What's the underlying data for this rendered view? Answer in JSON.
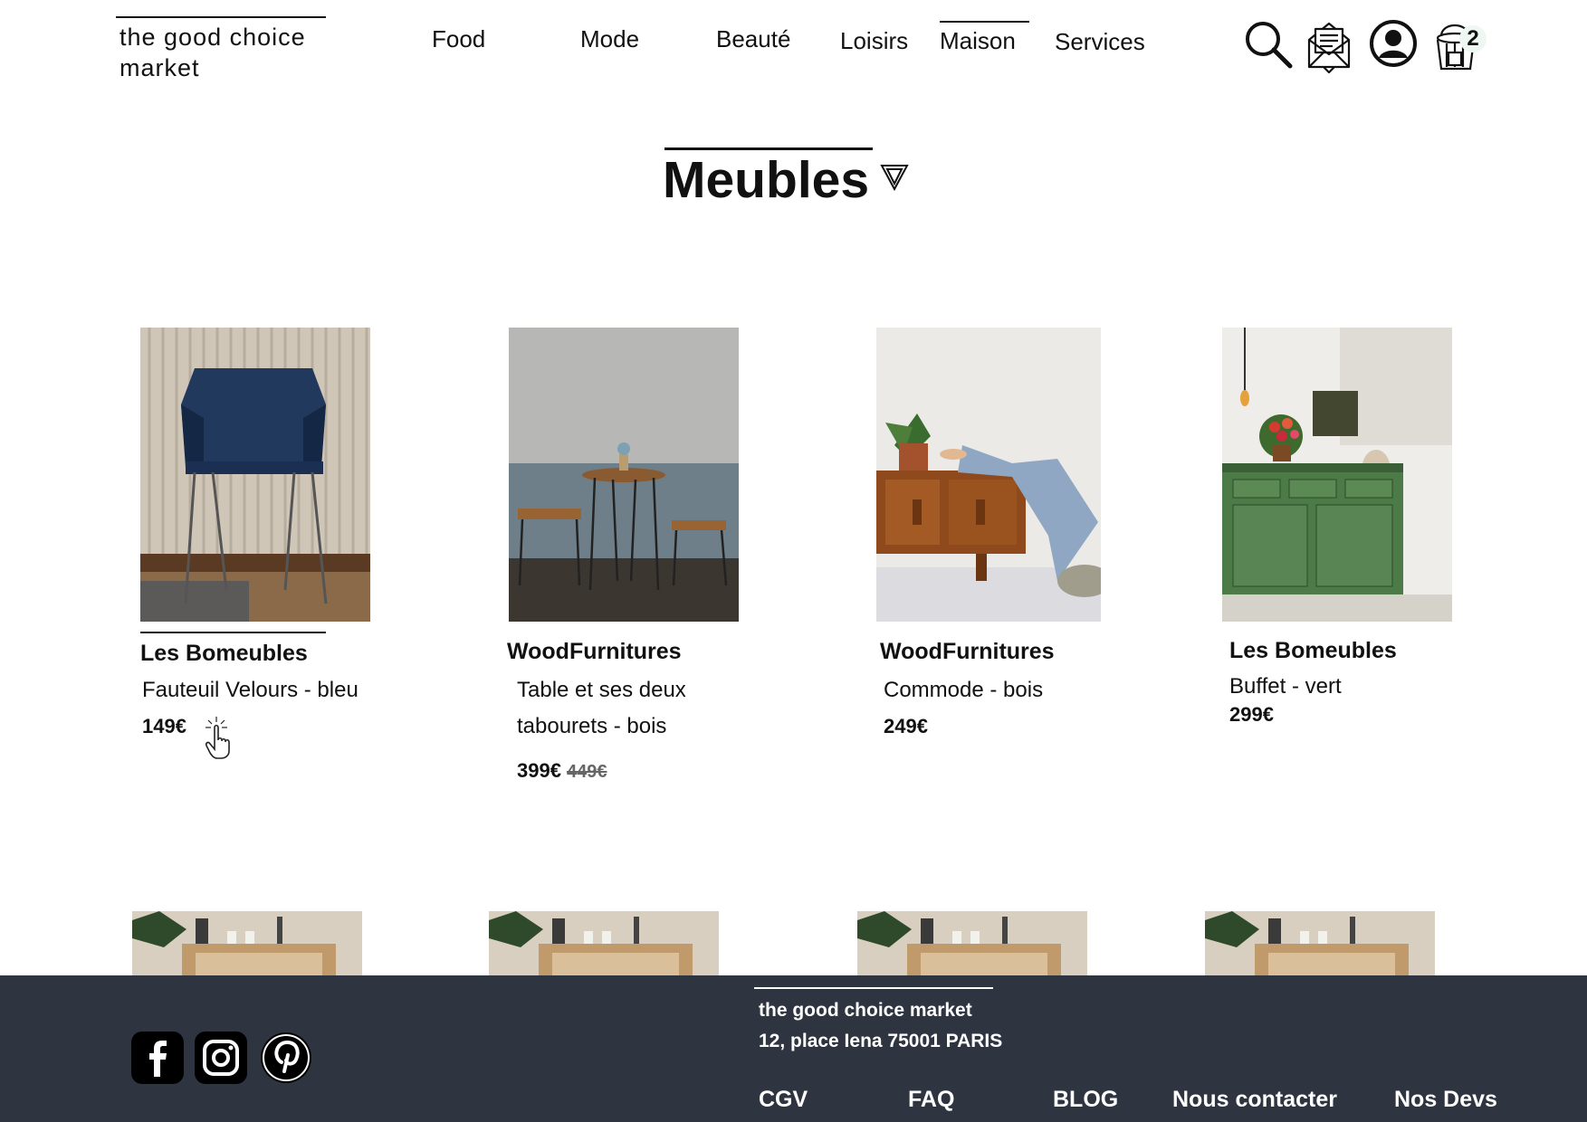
{
  "brand": {
    "line1": "the good choice",
    "line2": "market"
  },
  "nav": {
    "items": [
      {
        "label": "Food"
      },
      {
        "label": "Mode"
      },
      {
        "label": "Beauté"
      },
      {
        "label": "Loisirs"
      },
      {
        "label": "Maison",
        "active": true
      },
      {
        "label": "Services"
      }
    ]
  },
  "header_icons": [
    "search-icon",
    "mail-icon",
    "user-icon",
    "basket-icon"
  ],
  "cart": {
    "count": "2"
  },
  "page": {
    "title": "Meubles"
  },
  "products": [
    {
      "brand": "Les Bomeubles",
      "name": "Fauteuil Velours - bleu",
      "price": "149€"
    },
    {
      "brand": "WoodFurnitures",
      "name": "Table et ses deux tabourets - bois",
      "price": "399€",
      "old_price": "449€"
    },
    {
      "brand": "WoodFurnitures",
      "name": "Commode - bois",
      "price": "249€"
    },
    {
      "brand": "Les Bomeubles",
      "name": "Buffet - vert",
      "price": "299€"
    }
  ],
  "footer": {
    "brand": "the good choice market",
    "address": "12, place Iena 75001 PARIS",
    "links": [
      {
        "label": "CGV"
      },
      {
        "label": "FAQ"
      },
      {
        "label": "BLOG"
      },
      {
        "label": "Nous contacter"
      },
      {
        "label": "Nos Devs"
      }
    ],
    "social": [
      "facebook-icon",
      "instagram-icon",
      "pinterest-icon"
    ]
  },
  "colors": {
    "footer_bg": "#2e3440",
    "text": "#111111",
    "old_price": "#666666"
  }
}
